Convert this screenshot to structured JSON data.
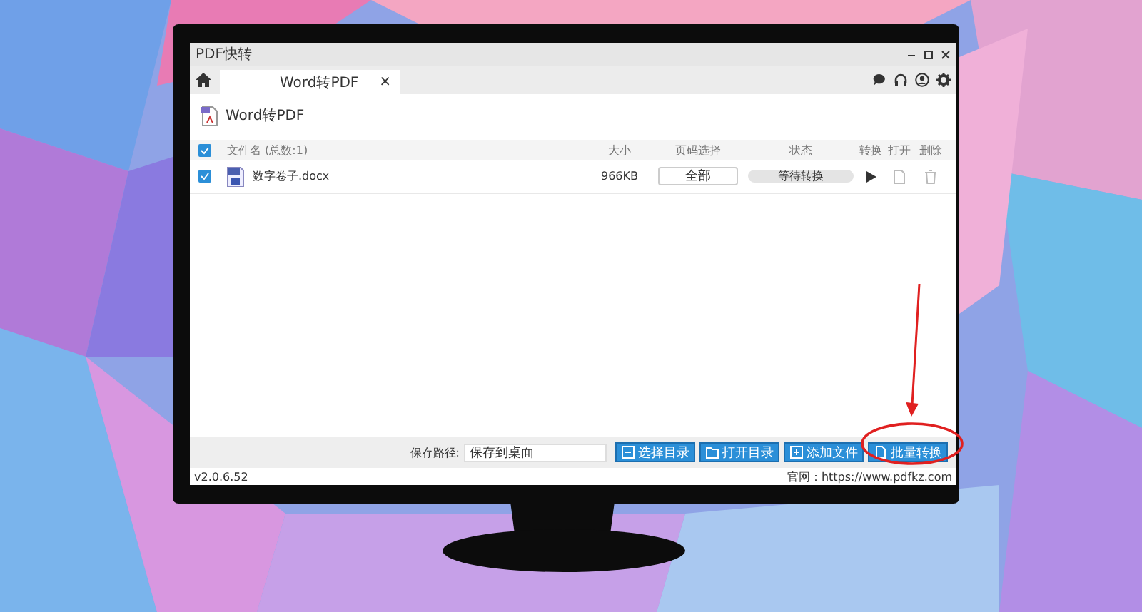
{
  "window": {
    "title": "PDF快转"
  },
  "tabs": [
    {
      "label": "Word转PDF",
      "close": "×",
      "selected": true
    }
  ],
  "page_header": {
    "title": "Word转PDF"
  },
  "table": {
    "select_all": {
      "checked": true
    },
    "columns": [
      "文件名 (总数:1)",
      "大小",
      "页码选择",
      "状态",
      "转换",
      "打开",
      "删除"
    ],
    "rows": [
      {
        "checked": true,
        "name": "数字卷子.docx",
        "size": "966KB",
        "pages": "全部",
        "status": "等待转换"
      }
    ]
  },
  "toolbar": {
    "save_label": "保存路径:",
    "save_path": "保存到桌面",
    "buttons": [
      {
        "label": "选择目录",
        "kind": "folder-select"
      },
      {
        "label": "打开目录",
        "kind": "folder-open"
      },
      {
        "label": "添加文件",
        "kind": "add"
      },
      {
        "label": "批量转换",
        "kind": "convert"
      }
    ]
  },
  "status_bar": {
    "version": "v2.0.6.52",
    "website": "官网：https://www.pdfkz.com"
  }
}
